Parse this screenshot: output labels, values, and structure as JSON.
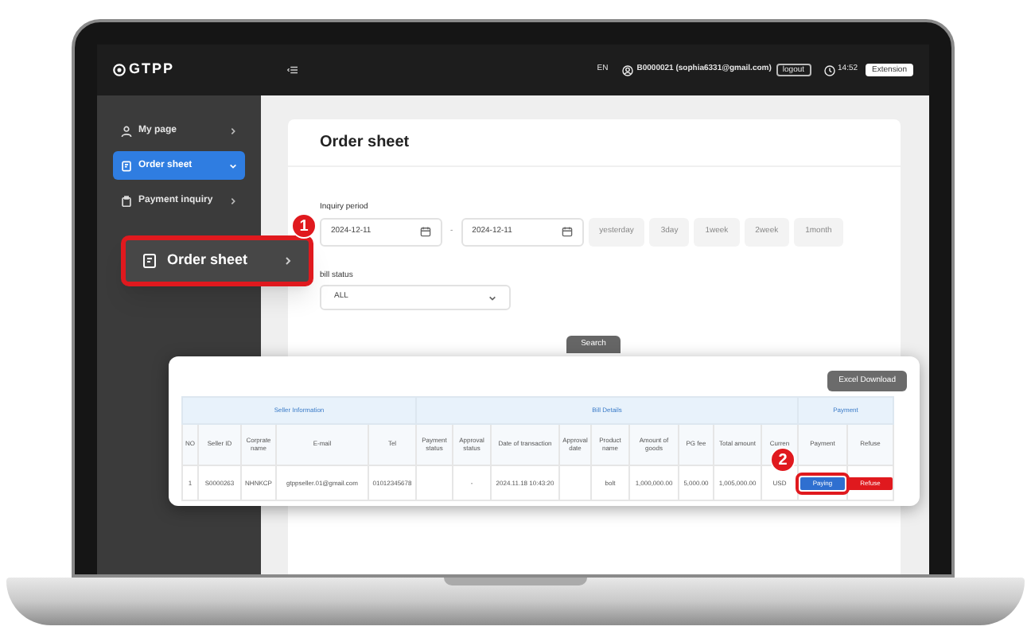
{
  "header": {
    "logo": "GTPP",
    "language": "EN",
    "user": "B0000021 (sophia6331@gmail.com)",
    "logout": "logout",
    "time": "14:52",
    "extension": "Extension"
  },
  "sidebar": {
    "items": [
      {
        "label": "My page",
        "kind": "person",
        "selected": false
      },
      {
        "label": "Order sheet",
        "kind": "sheet",
        "selected": true
      },
      {
        "label": "Payment inquiry",
        "kind": "clipboard",
        "selected": false
      }
    ]
  },
  "callouts": [
    {
      "number": "1",
      "label": "Order sheet"
    },
    {
      "number": "2"
    }
  ],
  "page": {
    "title": "Order sheet",
    "inquiry_label": "Inquiry period",
    "date_from": "2024-12-11",
    "date_separator": "-",
    "date_to": "2024-12-11",
    "presets": [
      "yesterday",
      "3day",
      "1week",
      "2week",
      "1month"
    ],
    "status_label": "bill status",
    "status_value": "ALL",
    "search": "Search"
  },
  "table": {
    "excel": "Excel Download",
    "groups": [
      {
        "label": "Seller Information",
        "columns": [
          "NO",
          "Seller ID",
          "Corprate name",
          "E-mail",
          "Tel"
        ]
      },
      {
        "label": "Bill Details",
        "columns": [
          "Payment status",
          "Approval status",
          "Date of transaction",
          "Approval date",
          "Product name",
          "Amount of goods",
          "PG fee",
          "Total amount",
          "Curren"
        ]
      },
      {
        "label": "Payment",
        "columns": [
          "Payment",
          "Refuse"
        ]
      }
    ],
    "rows": [
      {
        "cells": [
          "1",
          "S0000263",
          "NHNKCP",
          "gtppseller.01@gmail.com",
          "01012345678",
          null,
          "-",
          "2024.11.18 10:43:20",
          null,
          "bolt",
          "1,000,000.00",
          "5,000.00",
          "1,005,000.00",
          "USD"
        ],
        "actions": [
          {
            "label": "Paying",
            "kind": "primary",
            "highlighted": true
          },
          {
            "label": "Refuse",
            "kind": "danger",
            "highlighted": false
          }
        ]
      }
    ]
  }
}
